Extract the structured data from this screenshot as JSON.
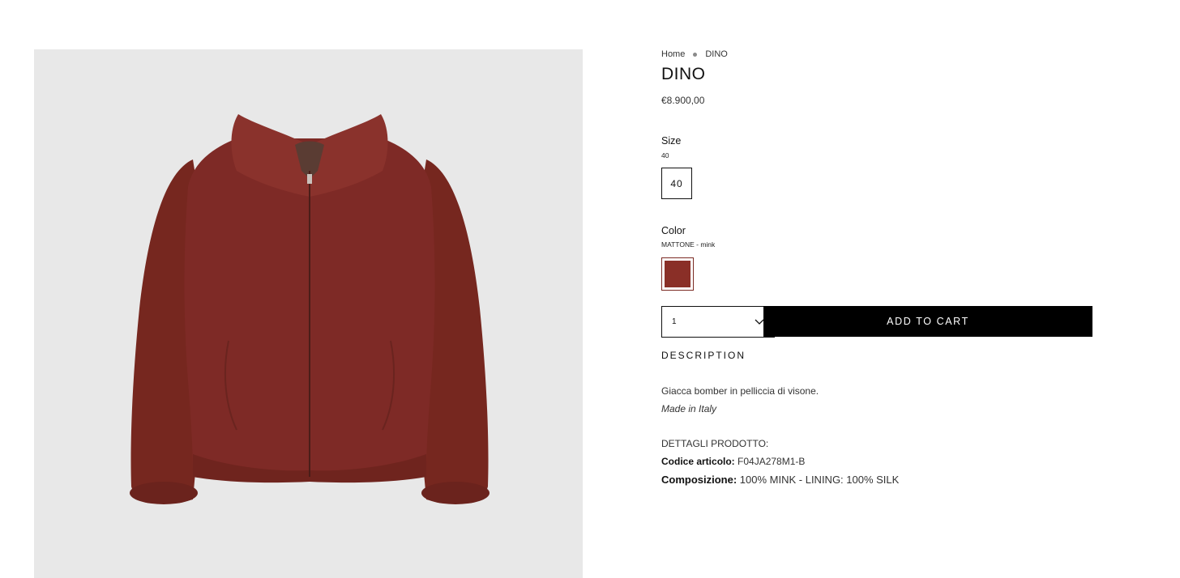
{
  "breadcrumb": {
    "home": "Home",
    "current": "DINO"
  },
  "product": {
    "title": "DINO",
    "price": "€8.900,00",
    "image_alt": "Red mink fur bomber jacket"
  },
  "size": {
    "label": "Size",
    "selected": "40",
    "options": [
      "40"
    ]
  },
  "color": {
    "label": "Color",
    "selected": "MATTONE - mink",
    "swatch_color": "#8a2f27"
  },
  "quantity": {
    "value": "1"
  },
  "cart": {
    "add_label": "ADD TO CART"
  },
  "description": {
    "heading": "DESCRIPTION",
    "text": "Giacca bomber in pelliccia di visone.",
    "origin": "Made in Italy",
    "details_heading": "DETTAGLI PRODOTTO:",
    "code_label": "Codice articolo:",
    "code_value": "F04JA278M1-B",
    "composition_label": "Composizione:",
    "composition_value": "100% MINK - LINING: 100% SILK"
  },
  "colors": {
    "accent": "#000000",
    "panel_bg": "#e8e8e8",
    "fur": "#7e2a26"
  }
}
